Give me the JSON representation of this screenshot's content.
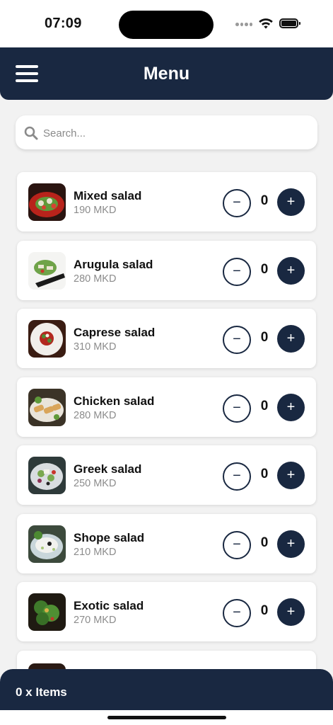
{
  "status_bar": {
    "time": "07:09"
  },
  "header": {
    "title": "Menu",
    "menu_icon": "hamburger-icon"
  },
  "search": {
    "placeholder": "Search...",
    "value": "",
    "icon": "search-icon"
  },
  "items": [
    {
      "name": "Mixed salad",
      "price": "190 MKD",
      "quantity": "0",
      "minus_label": "−",
      "plus_label": "+"
    },
    {
      "name": "Arugula salad",
      "price": "280 MKD",
      "quantity": "0",
      "minus_label": "−",
      "plus_label": "+"
    },
    {
      "name": "Caprese salad",
      "price": "310 MKD",
      "quantity": "0",
      "minus_label": "−",
      "plus_label": "+"
    },
    {
      "name": "Chicken salad",
      "price": "280 MKD",
      "quantity": "0",
      "minus_label": "−",
      "plus_label": "+"
    },
    {
      "name": "Greek salad",
      "price": "250 MKD",
      "quantity": "0",
      "minus_label": "−",
      "plus_label": "+"
    },
    {
      "name": "Shope salad",
      "price": "210 MKD",
      "quantity": "0",
      "minus_label": "−",
      "plus_label": "+"
    },
    {
      "name": "Exotic salad",
      "price": "270 MKD",
      "quantity": "0",
      "minus_label": "−",
      "plus_label": "+"
    }
  ],
  "footer": {
    "cart_summary": "0 x Items"
  },
  "colors": {
    "primary": "#192841",
    "background": "#f2f2f2",
    "card": "#ffffff",
    "price_text": "#8c8c8c"
  }
}
